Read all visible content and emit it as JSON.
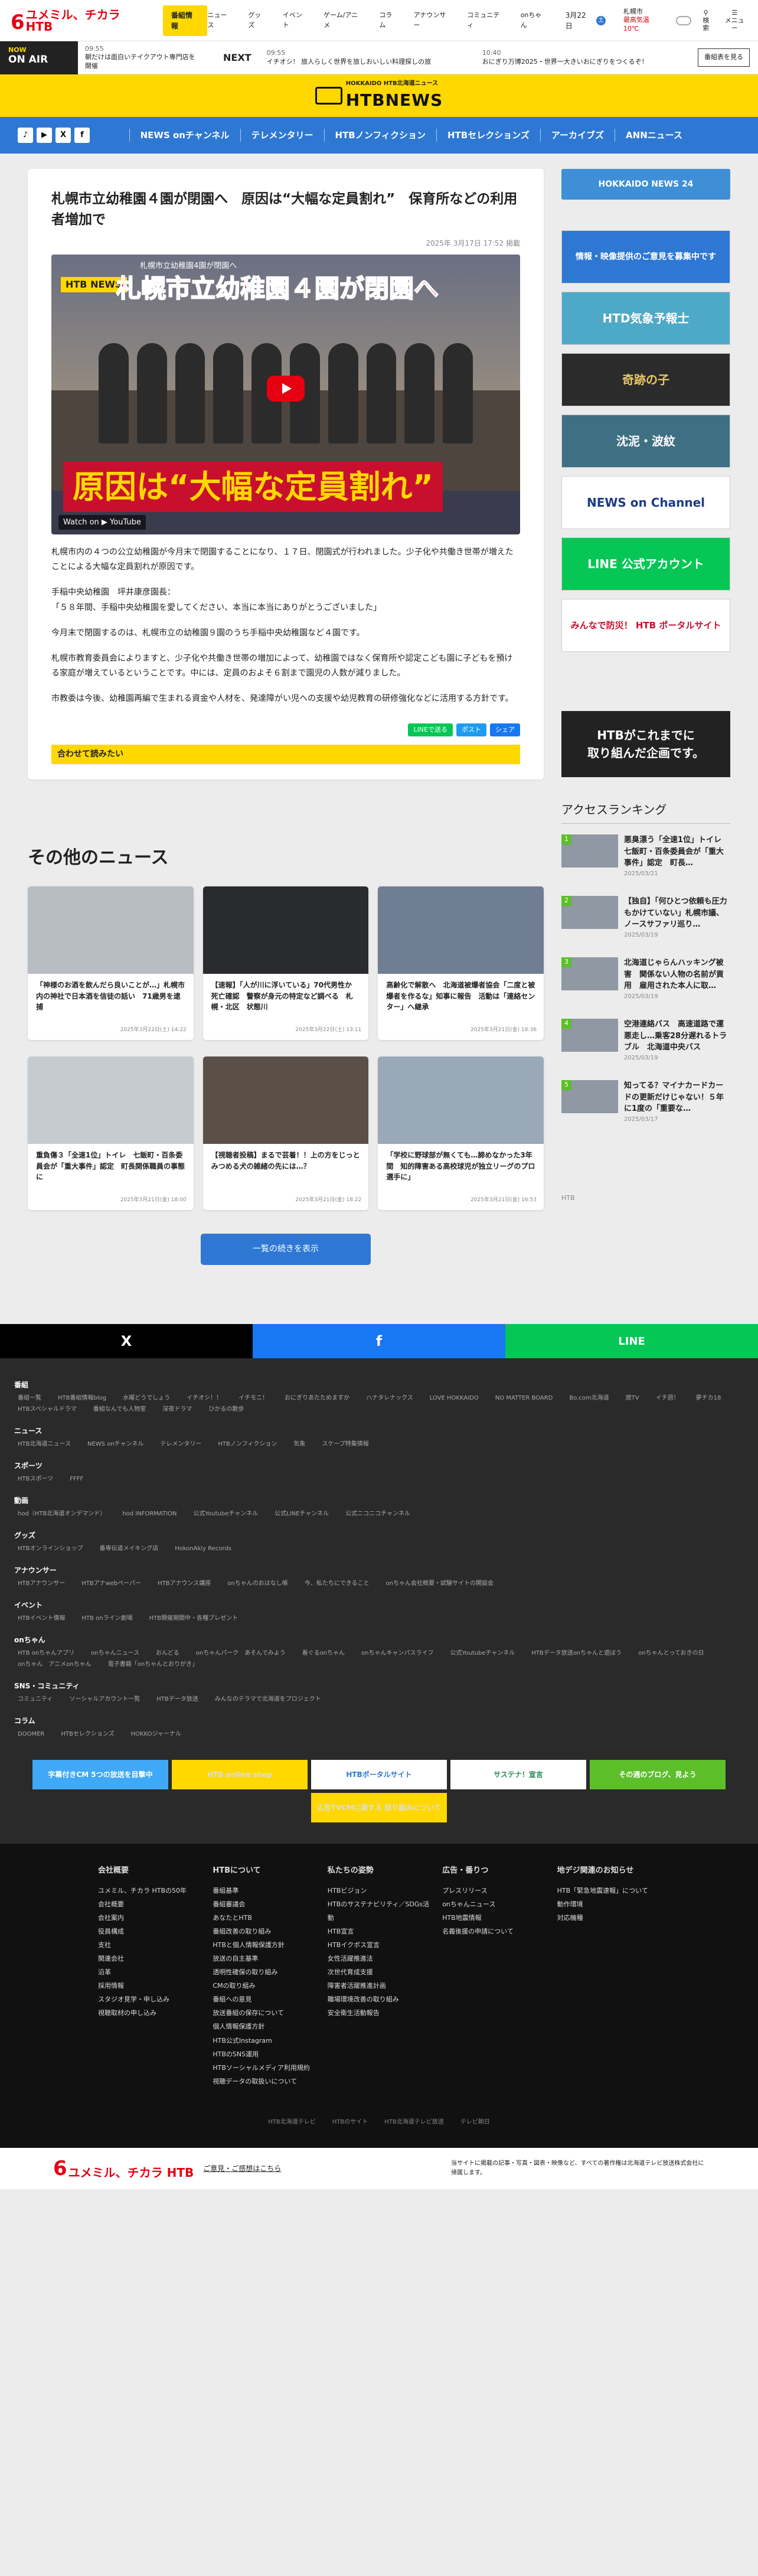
{
  "header": {
    "logo_six": "6",
    "logo_text": "ユメミル、チカラ HTB",
    "yellow_btn": "番組情報",
    "nav": [
      "ニュース",
      "グッズ",
      "イベント",
      "ゲーム/アニメ",
      "コラム",
      "アナウンサー",
      "コミュニティ",
      "onちゃん"
    ],
    "date": "3月22日",
    "date_badge": "土",
    "weather_city": "札幌市",
    "weather_temp": "最高気温 10℃",
    "icons": [
      "検索",
      "メニュー"
    ]
  },
  "onair": {
    "now": "NOW",
    "on_air": "ON AIR",
    "cur_time": "09:55",
    "cur_title": "朝だけは面白いテイクアウト専門店を開催",
    "next_label": "NEXT",
    "next1_time": "09:55",
    "next1_title": "イチオシ！ 旅人らしく世界を旅しおいしい料理探しの旅",
    "next2_time": "10:40",
    "next2_title": "おにぎり万博2025・世界一大きいおにぎりをつくるぞ！",
    "prog_link": "番組表を見る"
  },
  "banner": {
    "ring": "HOKKAIDO HTB北海道ニュース",
    "word": "HTBNEWS"
  },
  "nav": {
    "social": [
      "♪",
      "▶",
      "X",
      "f"
    ],
    "items": [
      "NEWS onチャンネル",
      "テレメンタリー",
      "HTBノンフィクション",
      "HTBセレクションズ",
      "アーカイブズ",
      "ANNニュース"
    ]
  },
  "article": {
    "title": "札幌市立幼稚園４園が閉園へ　原因は“大幅な定員割れ”　保育所などの利用者増加で",
    "date": "2025年 3月17日 17:52 掲載",
    "video": {
      "small": "札幌市立幼稚園4園が閉園へ",
      "headline": "札幌市立幼稚園４園が閉園へ",
      "bottom": "原因は“大幅な定員割れ”",
      "news": "HTB NEWS",
      "watch": "Watch on ▶ YouTube"
    },
    "paras": [
      "札幌市内の４つの公立幼稚園が今月末で閉園することになり、１７日、閉園式が行われました。少子化や共働き世帯が増えたことによる大幅な定員割れが原因です。",
      "手稲中央幼稚園　坪井康彦園長：\n「５８年間、手稲中央幼稚園を愛してください、本当に本当にありがとうございました」",
      "今月末で閉園するのは、札幌市立の幼稚園９園のうち手稲中央幼稚園など４園です。",
      "札幌市教育委員会によりますと、少子化や共働き世帯の増加によって、幼稚園ではなく保育所や認定こども園に子どもを預ける家庭が増えているということです。中には、定員のおよそ６割まで園児の人数が減りました。",
      "市教委は今後、幼稚園再編で生まれる資金や人材を、発達障がい児への支援や幼児教育の研修強化などに活用する方針です。"
    ],
    "share": [
      "LINEで送る",
      "ポスト",
      "シェア"
    ],
    "readtoo": "合わせて読みたい"
  },
  "other": {
    "title": "その他のニュース",
    "more": "一覧の続きを表示",
    "cards": [
      {
        "t": "「神様のお酒を飲んだら良いことが…」札幌市内の神社で日本酒を信徒の話い　71歳男を逮捕",
        "d": "2025年3月22日(土) 14:22"
      },
      {
        "t": "【速報】「人が川に浮いている」70代男性か　死亡確認　警察が身元の特定など調べる　札幌・北区　状態川",
        "d": "2025年3月22日(土) 13:11"
      },
      {
        "t": "高齢化で解散へ　北海道被爆者協会「二度と被爆者を作るな」知事に報告　活動は「連絡センター」へ継承",
        "d": "2025年3月21日(金) 18:36"
      },
      {
        "t": "重負傷３「全速1位」トイレ　七飯町・百条委員会が「重大事件」認定　町長関係職員の事態に",
        "d": "2025年3月21日(金) 18:00"
      },
      {
        "t": "【視聴者投稿】まるで芸着！！上の方をじっとみつめる犬の雑緒の先には…？",
        "d": "2025年3月21日(金) 18:22"
      },
      {
        "t": "「学校に野球部が無くても…諦めなかった3年間　知的障害ある高校球児が独立リーグのプロ選手に」",
        "d": "2025年3月21日(金) 16:53"
      }
    ]
  },
  "side": {
    "news24": "HOKKAIDO NEWS 24",
    "ads": [
      "情報・映像提供のご意見を募集中です",
      "HTD気象予報士",
      "奇跡の子",
      "沈泥・波紋",
      "NEWS on Channel",
      "LINE 公式アカウント",
      "みんなで防災！ HTB ポータルサイト"
    ],
    "black": "HTBがこれまでに\n取り組んだ企画です。",
    "rank_title": "アクセスランキング",
    "ranks": [
      {
        "n": "1",
        "t": "悪臭漂う「全速1位」トイレ　七飯町・百条委員会が「重大事件」認定　町長…",
        "d": "2025/03/21"
      },
      {
        "n": "2",
        "t": "【独自】「何ひとつ依頼も圧力もかけていない」札幌市議、ノースサファリ巡り…",
        "d": "2025/03/19"
      },
      {
        "n": "3",
        "t": "北海道じゃらんハッキング被害　関係ない人物の名前が貢用　雇用された本人に取…",
        "d": "2025/03/19"
      },
      {
        "n": "4",
        "t": "空港連絡バス　高速道路で運悪走し…乗客28分遅れるトラブル　北海道中央バス",
        "d": "2025/03/19"
      },
      {
        "n": "5",
        "t": "知ってる？マイナカードカードの更新だけじゃない！５年に1度の「重要な…",
        "d": "2025/03/17"
      }
    ],
    "foot": "HTB"
  },
  "share_row": [
    "X",
    "f",
    "LINE"
  ],
  "sitemap": [
    {
      "h": "番組",
      "l": [
        "番組一覧",
        "HTB番組情報blog",
        "水曜どうでしょう",
        "イチオシ！！",
        "イチモニ！",
        "おにぎりあたためますか",
        "ハナタレナックス",
        "LOVE HOKKAIDO",
        "NO MATTER BOARD",
        "Bo.com北海道",
        "旅TV",
        "イチ週！",
        "夢チカ18",
        "HTBスペシャルドラマ",
        "番組なんでも人物室",
        "深夜ドラマ",
        "ひかるの散歩"
      ]
    },
    {
      "h": "ニュース",
      "l": [
        "HTB北海道ニュース",
        "NEWS onチャンネル",
        "テレメンタリー",
        "HTBノンフィクション",
        "気象",
        "スケープ特集情報"
      ]
    },
    {
      "h": "スポーツ",
      "l": [
        "HTBスポーツ",
        "FFFF"
      ]
    },
    {
      "h": "動画",
      "l": [
        "hod（HTB北海道オンデマンド）",
        "hod INFORMATION",
        "公式Youtubeチャンネル",
        "公式LINEチャンネル",
        "公式ニコニコチャンネル"
      ]
    },
    {
      "h": "グッズ",
      "l": [
        "HTBオンラインショップ",
        "番専伝道メイキング店",
        "HokonAkiy Records"
      ]
    },
    {
      "h": "アナウンサー",
      "l": [
        "HTBアナウンサー",
        "HTBアナwebペーパー",
        "HTBアナウンス講座",
        "onちゃんのおはなし帳",
        "今、私たちにできること",
        "onちゃん会社概要・試験サイトの開設会"
      ]
    },
    {
      "h": "イベント",
      "l": [
        "HTBイベント情報",
        "HTB onライン劇場",
        "HTB開催期間中・各種プレゼント"
      ]
    },
    {
      "h": "onちゃん",
      "l": [
        "HTB onちゃんアプリ",
        "onちゃんニュース",
        "おんどる",
        "onちゃんパーク　あそんでみよう",
        "着ぐるonちゃん",
        "onちゃんキャンパスライフ",
        "公式Youtubeチャンネル",
        "HTBデータ放送onちゃんと遊ぼう",
        "onちゃんとっておきの日",
        "onちゃん　アニメonちゃん",
        "電子書籍「onちゃんとおりがき」"
      ]
    },
    {
      "h": "SNS・コミュニティ",
      "l": [
        "コミュニティ",
        "ソーシャルアカウント一覧",
        "HTBデータ放送",
        "みんなのテラマで北海道をプロジェクト"
      ]
    },
    {
      "h": "コラム",
      "l": [
        "DOOMER",
        "HTBセレクションズ",
        "HOKKOジャーナル"
      ]
    }
  ],
  "bnrs": [
    "字幕付きCM 5つの放送を目撃中",
    "HTB online shop",
    "HTBポータルサイト",
    "サステナ！宣言",
    "その週のブログ、見よう",
    "広告TVCMに関する 取り組みについて"
  ],
  "footer": {
    "cols": [
      {
        "h": "会社概要",
        "l": [
          "ユメミル、チカラ HTBの50年",
          "会社概要",
          "会社案内",
          "役員構成",
          "支社",
          "関連会社",
          "沿革",
          "採用情報",
          "スタジオ見学・申し込み",
          "視聴取材の申し込み"
        ]
      },
      {
        "h": "HTBについて",
        "l": [
          "番組基準",
          "番組審議会",
          "あなたとHTB",
          "番組改善の取り組み",
          "HTBと個人情報保護方針",
          "放送の自主基準",
          "透明性確保の取り組み",
          "CMの取り組み",
          "番組への意見",
          "放送番組の保存について",
          "個人情報保護方針",
          "HTB公式Instagram",
          "HTBのSNS運用",
          "HTBソーシャルメディア利用規約",
          "視聴データの取扱いについて"
        ]
      },
      {
        "h": "私たちの姿勢",
        "l": [
          "HTBビジョン",
          "HTBのサステナビリティ／SDGs活動",
          "HTB宣言",
          "HTBイクボス宣言",
          "女性活躍推進法",
          "次世代育成支援",
          "障害者活躍推進計画",
          "職場環境改善の取り組み",
          "安全衛生活動報告"
        ]
      },
      {
        "h": "広告・番りつ",
        "l": [
          "プレスリリース",
          "onちゃんニュース",
          "HTB地震情報",
          "名義後援の申請について"
        ]
      },
      {
        "h": "地デジ関連のお知らせ",
        "l": [
          "HTB「緊急地震速報」について",
          "動作環境",
          "対応機種"
        ]
      }
    ],
    "links": [
      "HTB北海道テレビ",
      "HTBのサイト",
      "HTB北海道テレビ放送",
      "テレビ朝日"
    ],
    "note": "当サイトに掲載の記事・写真・図表・映像など、すべての著作権は北海道テレビ放送株式会社に帰属します。",
    "contact": "ご意見・ご感想はこちら"
  }
}
